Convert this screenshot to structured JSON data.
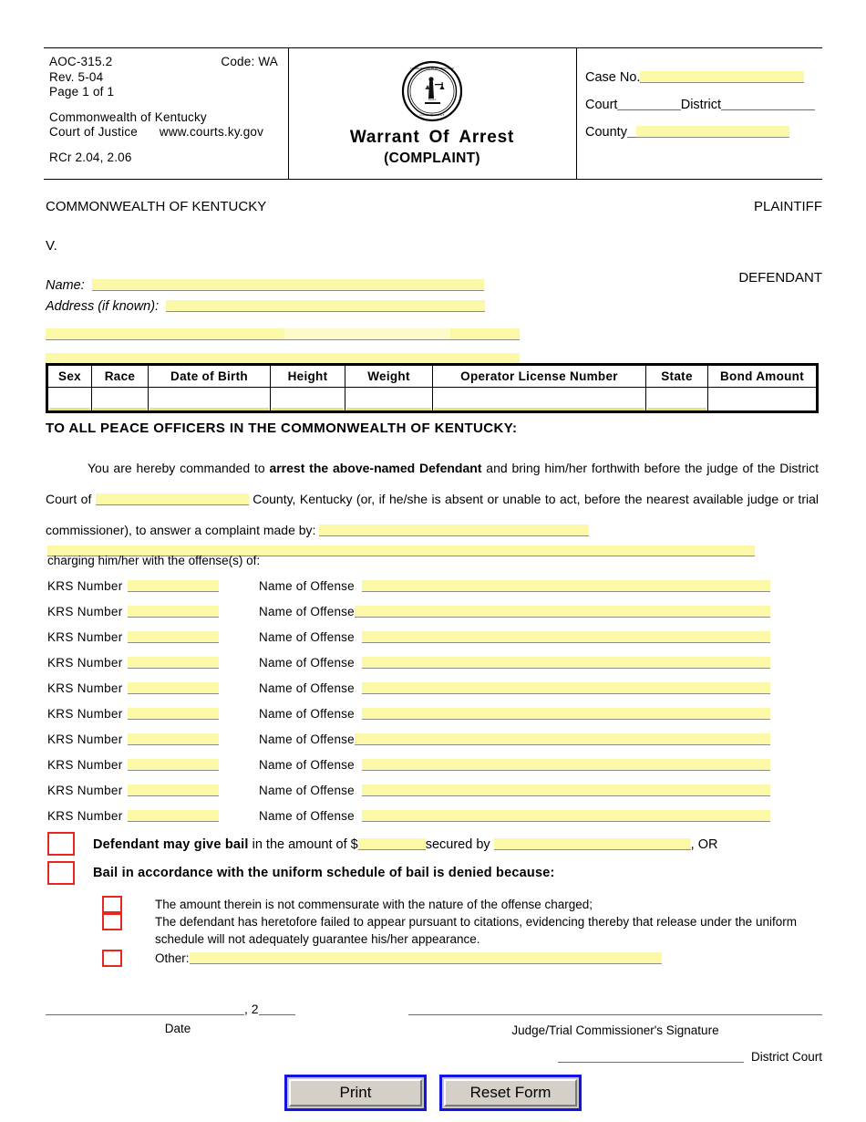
{
  "header": {
    "form_number": "AOC-315.2",
    "code": "Code: WA",
    "revision": "Rev. 5-04",
    "page": "Page 1 of 1",
    "commonwealth": "Commonwealth of Kentucky",
    "court_of_justice": "Court of Justice",
    "website": "www.courts.ky.gov",
    "rule_citation": "RCr 2.04, 2.06",
    "title_warrant": "Warrant",
    "title_of": "Of",
    "title_arrest": "Arrest",
    "subtitle": "(COMPLAINT)",
    "seal_name": "kentucky-court-of-justice-seal"
  },
  "case_info": {
    "case_no_label": "Case No.",
    "case_no_value": "",
    "court_label": "Court",
    "court_value": "",
    "district_label": "District",
    "district_value": "",
    "county_label": "County",
    "county_value": ""
  },
  "parties": {
    "plaintiff_name": "COMMONWEALTH OF KENTUCKY",
    "plaintiff_role": "PLAINTIFF",
    "versus": "V.",
    "defendant_role": "DEFENDANT",
    "name_label": "Name:",
    "name_value": "",
    "address_label": "Address (if known):",
    "address_value": "",
    "address_line2_city": "",
    "address_line2_state": "",
    "address_line2_zip": "",
    "address_line3": ""
  },
  "demographics": {
    "columns": [
      "Sex",
      "Race",
      "Date of Birth",
      "Height",
      "Weight",
      "Operator License Number",
      "State",
      "Bond Amount"
    ],
    "values": [
      "",
      "",
      "",
      "",
      "",
      "",
      "",
      ""
    ]
  },
  "command": {
    "heading": "TO ALL PEACE OFFICERS IN THE COMMONWEALTH OF KENTUCKY:",
    "text_1": "You are hereby commanded to ",
    "bold_1": "arrest the above-named Defendant",
    "text_2": " and bring him/her forthwith before the judge of the District Court of ",
    "county_field_value": "",
    "text_3": " County, Kentucky (or, if he/she is absent or unable to act, before the nearest available judge or trial commissioner), to answer a complaint made by: ",
    "complainant_value": "",
    "charging_line_value": "",
    "charging_label": "charging him/her with the offense(s) of:"
  },
  "charges": {
    "krs_label": "KRS Number",
    "offense_label": "Name of Offense",
    "rows": [
      {
        "krs_number": "",
        "offense_name": ""
      },
      {
        "krs_number": "",
        "offense_name": ""
      },
      {
        "krs_number": "",
        "offense_name": ""
      },
      {
        "krs_number": "",
        "offense_name": ""
      },
      {
        "krs_number": "",
        "offense_name": ""
      },
      {
        "krs_number": "",
        "offense_name": ""
      },
      {
        "krs_number": "",
        "offense_name": ""
      },
      {
        "krs_number": "",
        "offense_name": ""
      },
      {
        "krs_number": "",
        "offense_name": ""
      },
      {
        "krs_number": "",
        "offense_name": ""
      }
    ]
  },
  "bail": {
    "option1_bold": "Defendant may give bail",
    "option1_mid": " in the amount of $",
    "option1_amount": "",
    "option1_secured": "secured by ",
    "option1_secured_value": "",
    "option1_or": ", OR",
    "option2": "Bail in accordance with the uniform schedule of bail is denied because:",
    "reason1": "The amount therein is not commensurate with the nature of the offense charged;",
    "reason2": "The defendant has heretofore failed to appear pursuant to citations, evidencing thereby that release under the uniform schedule will not adequately guarantee his/her appearance.",
    "reason3_label": "Other:",
    "reason3_value": "",
    "checkbox_color": "#e8251f"
  },
  "signature": {
    "date_value": "",
    "year_prefix": ", 2",
    "year_value": "",
    "date_caption": "Date",
    "judge_value": "",
    "judge_caption": "Judge/Trial Commissioner's Signature",
    "district_value": "",
    "district_caption": "District Court"
  },
  "buttons": {
    "print": "Print",
    "reset": "Reset Form",
    "focus_color": "#1414e0"
  }
}
